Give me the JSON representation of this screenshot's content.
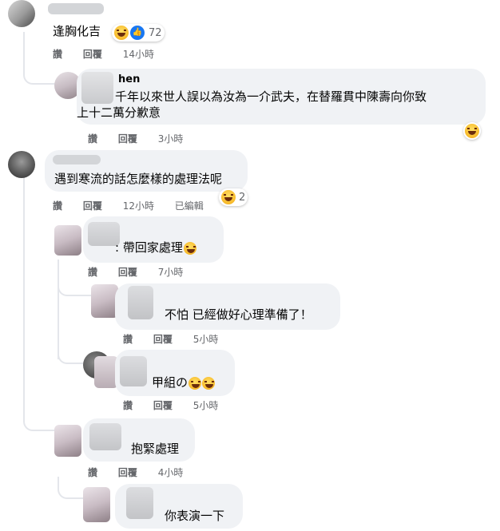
{
  "actions": {
    "like": "讚",
    "reply": "回覆",
    "edited": "已編輯"
  },
  "comments": [
    {
      "id": "c1",
      "text": "逢胸化吉",
      "time": "14小時",
      "reaction_count": "72"
    },
    {
      "id": "c1r1",
      "name": "hen",
      "text_line1": "千年以來世人誤以為汝為一介武夫，在替羅貫中陳壽向你致",
      "text_line2": "上十二萬分歉意",
      "time": "3小時"
    },
    {
      "id": "c2",
      "text": "遇到寒流的話怎麼樣的處理法呢",
      "time": "12小時",
      "reaction_count": "2"
    },
    {
      "id": "c2r1",
      "text": ": 帶回家處理",
      "time": "7小時"
    },
    {
      "id": "c2r1a",
      "text": "不怕 已經做好心理準備了！",
      "time": "5小時"
    },
    {
      "id": "c2r1b",
      "text": "甲組の",
      "time": "5小時"
    },
    {
      "id": "c2r2",
      "text": "抱緊處理",
      "time": "4小時"
    },
    {
      "id": "c2r2a",
      "text": "你表演一下"
    }
  ],
  "colors": {
    "bubble": "#f0f2f5",
    "meta": "#65676b",
    "like_blue": "#1877f2",
    "emoji_yellow": "#f7b928"
  },
  "icons": [
    "laughing-emoji-icon",
    "like-icon",
    "rofl-emoji-icon",
    "grin-emoji-icon"
  ]
}
